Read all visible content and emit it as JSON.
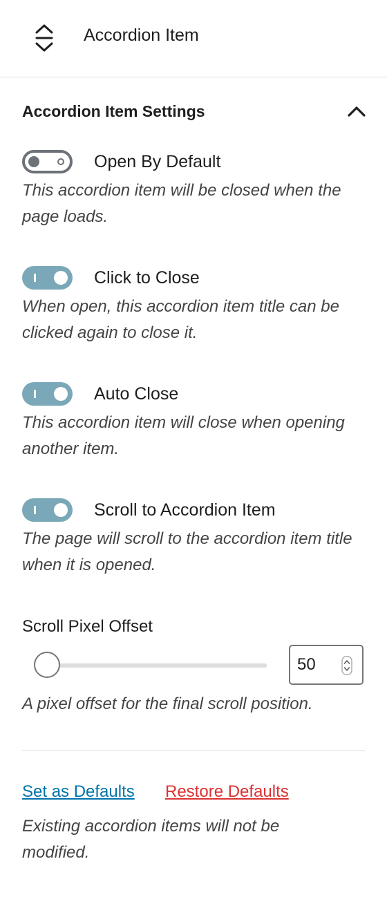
{
  "block": {
    "icon": "accordion-icon",
    "title": "Accordion Item"
  },
  "panel": {
    "title": "Accordion Item Settings",
    "collapse_icon": "chevron-up-icon"
  },
  "toggles": [
    {
      "label": "Open By Default",
      "checked": false,
      "help": "This accordion item will be closed when the page loads."
    },
    {
      "label": "Click to Close",
      "checked": true,
      "help": "When open, this accordion item title can be clicked again to close it."
    },
    {
      "label": "Auto Close",
      "checked": true,
      "help": "This accordion item will close when opening another item."
    },
    {
      "label": "Scroll to Accordion Item",
      "checked": true,
      "help": "The page will scroll to the accordion item title when it is opened."
    }
  ],
  "scroll_offset": {
    "label": "Scroll Pixel Offset",
    "value": "50",
    "help": "A pixel offset for the final scroll position."
  },
  "footer": {
    "set_defaults": "Set as Defaults",
    "restore_defaults": "Restore Defaults",
    "help": "Existing accordion items will not be modified."
  },
  "colors": {
    "toggle_on": "#7aa8b9",
    "toggle_off_border": "#6d7278",
    "link": "#0073aa",
    "destructive_link": "#dc3232"
  }
}
